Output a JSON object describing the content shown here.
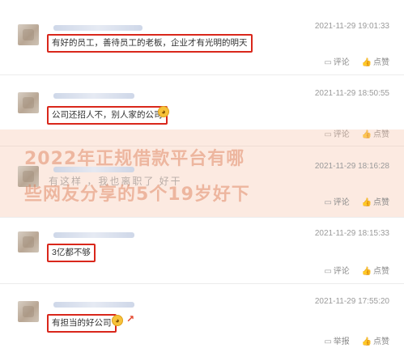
{
  "comments": [
    {
      "time": "2021-11-29 19:01:33",
      "text": "有好的员工，善待员工的老板，企业才有光明的明天",
      "reply": "评论",
      "like": "点赞"
    },
    {
      "time": "2021-11-29 18:50:55",
      "text": "公司还招人不，别人家的公司",
      "reply": "评论",
      "like": "点赞"
    },
    {
      "time": "2021-11-29 18:16:28",
      "text": "有这样    ，我也离职了    好干   ",
      "reply": "评论",
      "like": "点赞"
    },
    {
      "time": "2021-11-29 18:15:33",
      "text": "3亿都不够",
      "reply": "评论",
      "like": "点赞"
    },
    {
      "time": "2021-11-29 17:55:20",
      "text": "有担当的好公司",
      "reply": "举报",
      "like": "点赞"
    }
  ],
  "banner": {
    "line1": "2022年正规借款平台有哪",
    "line2": "些网友分享的5个19岁好下"
  },
  "icons": {
    "reply": "comment-icon",
    "like": "thumb-up-icon",
    "emoji": "laughing-emoji-icon",
    "trend": "trend-up-icon"
  },
  "colors": {
    "highlight_border": "#d9271b",
    "timestamp": "#9a9a9a",
    "banner_overlay": "#f5c4a8"
  }
}
